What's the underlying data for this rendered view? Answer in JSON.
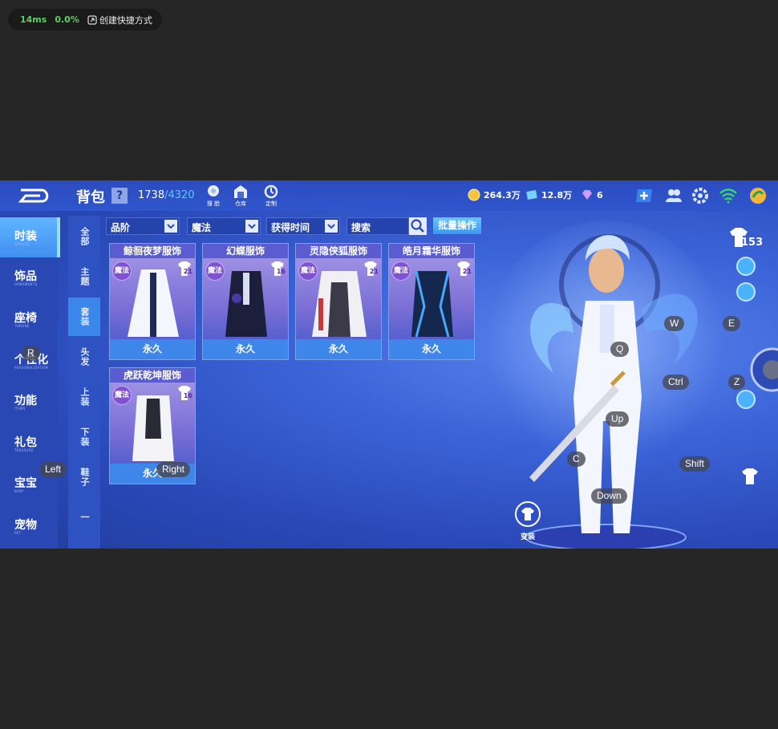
{
  "overlay": {
    "latency": "14ms",
    "loss": "0.0%",
    "shortcut_label": "创建快捷方式"
  },
  "header": {
    "title": "背包",
    "help": "?",
    "capacity_used": "1738",
    "capacity_max": "/4320",
    "icons": [
      {
        "name": "dye",
        "label": "搜 脸"
      },
      {
        "name": "warehouse",
        "label": "仓库"
      },
      {
        "name": "custom",
        "label": "定制"
      }
    ],
    "currencies": [
      {
        "name": "gold",
        "value": "264.3万",
        "color": "#f6c53c"
      },
      {
        "name": "coupon",
        "value": "12.8万",
        "color": "#7ad0ff"
      },
      {
        "name": "diamond",
        "value": "6",
        "color": "#d59cff"
      }
    ]
  },
  "left_nav": [
    {
      "label": "时装",
      "sub": "APPAREL"
    },
    {
      "label": "饰品",
      "sub": "ORNAMENTS"
    },
    {
      "label": "座椅",
      "sub": "THRONE"
    },
    {
      "label": "个性化",
      "sub": "PERSONALIZATION"
    },
    {
      "label": "功能",
      "sub": "ITEMS"
    },
    {
      "label": "礼包",
      "sub": "TREASURE"
    },
    {
      "label": "宝宝",
      "sub": "BABY"
    },
    {
      "label": "宠物",
      "sub": "PET"
    }
  ],
  "sub_nav": [
    "全部",
    "主题",
    "套装",
    "头发",
    "上装",
    "下装",
    "鞋子",
    "一"
  ],
  "filters": {
    "quality": "品阶",
    "type": "魔法",
    "sort": "获得时间",
    "search_placeholder": "搜索",
    "batch_label": "批量操作"
  },
  "items": [
    {
      "name": "鲸徊夜梦服饰",
      "badge": "魔法",
      "level": "21",
      "duration": "永久"
    },
    {
      "name": "幻蝶服饰",
      "badge": "魔法",
      "level": "16",
      "duration": "永久"
    },
    {
      "name": "灵隐侠狐服饰",
      "badge": "魔法",
      "level": "21",
      "duration": "永久"
    },
    {
      "name": "皓月霜华服饰",
      "badge": "魔法",
      "level": "21",
      "duration": "永久"
    },
    {
      "name": "虎跃乾坤服饰",
      "badge": "魔法",
      "level": "16",
      "duration": "永久"
    }
  ],
  "character": {
    "outfit_count": "153",
    "change_label": "变装"
  },
  "keys": [
    "R",
    "Left",
    "Right",
    "W",
    "E",
    "Q",
    "Ctrl",
    "Z",
    "Up",
    "C",
    "Shift",
    "Down"
  ]
}
